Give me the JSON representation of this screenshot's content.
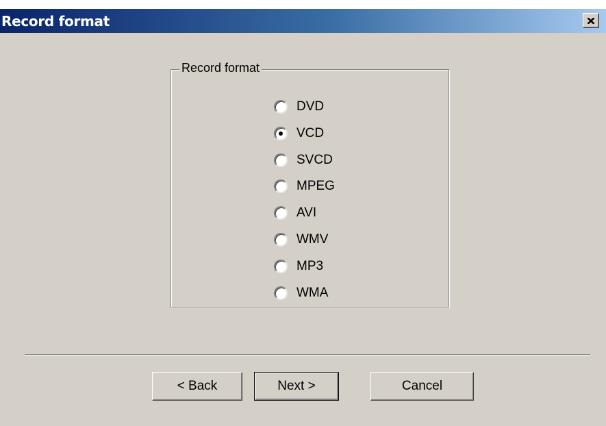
{
  "window": {
    "title": "Record format",
    "close_glyph": "close-icon"
  },
  "group": {
    "label": "Record format",
    "options": [
      {
        "label": "DVD",
        "checked": false
      },
      {
        "label": "VCD",
        "checked": true
      },
      {
        "label": "SVCD",
        "checked": false
      },
      {
        "label": "MPEG",
        "checked": false
      },
      {
        "label": "AVI",
        "checked": false
      },
      {
        "label": "WMV",
        "checked": false
      },
      {
        "label": "MP3",
        "checked": false
      },
      {
        "label": "WMA",
        "checked": false
      }
    ],
    "selected": "VCD"
  },
  "buttons": {
    "back": "< Back",
    "next": "Next >",
    "cancel": "Cancel"
  },
  "colors": {
    "face": "#d4d0c8",
    "title_start": "#0a246a",
    "title_end": "#a6caf0"
  }
}
